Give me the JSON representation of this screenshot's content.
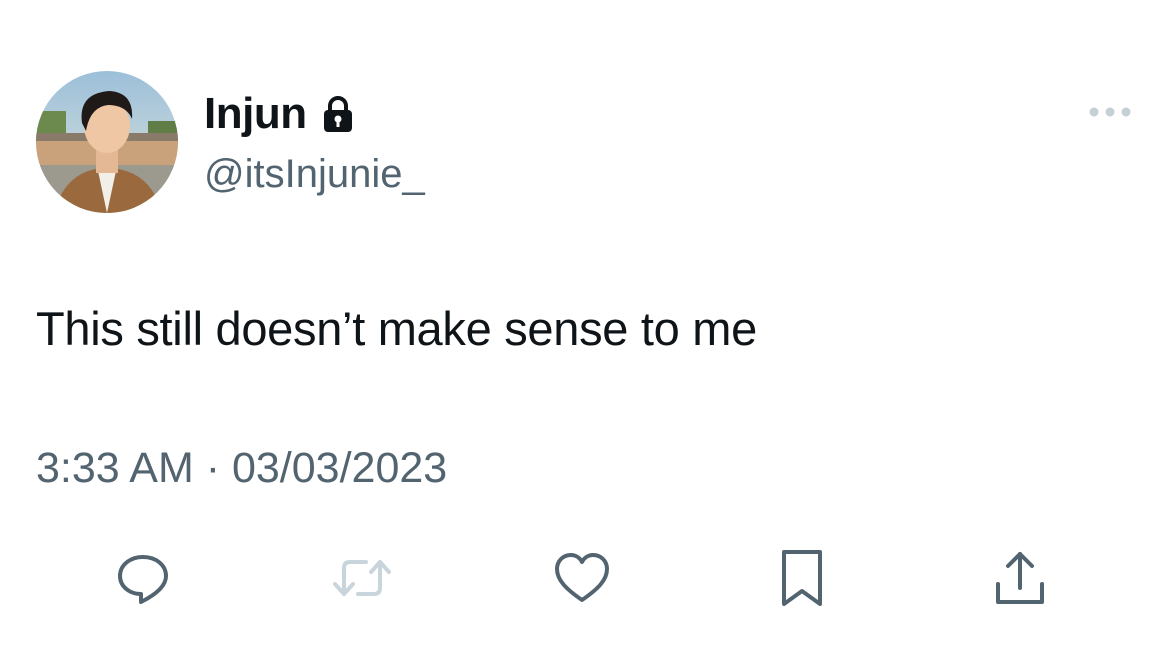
{
  "user": {
    "display_name": "Injun",
    "handle": "@itsInjunie_",
    "verified_icon": "lock-icon",
    "avatar_icon": "profile-avatar"
  },
  "tweet": {
    "text": "This still doesn’t make sense to me",
    "timestamp": "3:33 AM · 03/03/2023"
  },
  "actions": [
    {
      "name": "reply",
      "icon": "reply-icon"
    },
    {
      "name": "retweet",
      "icon": "retweet-icon",
      "disabled": true
    },
    {
      "name": "like",
      "icon": "heart-icon"
    },
    {
      "name": "bookmark",
      "icon": "bookmark-icon"
    },
    {
      "name": "share",
      "icon": "share-icon"
    }
  ],
  "colors": {
    "primary_text": "#0f1419",
    "secondary_text": "#536471",
    "icon": "#536471",
    "disabled_icon": "#c9d5dc"
  }
}
